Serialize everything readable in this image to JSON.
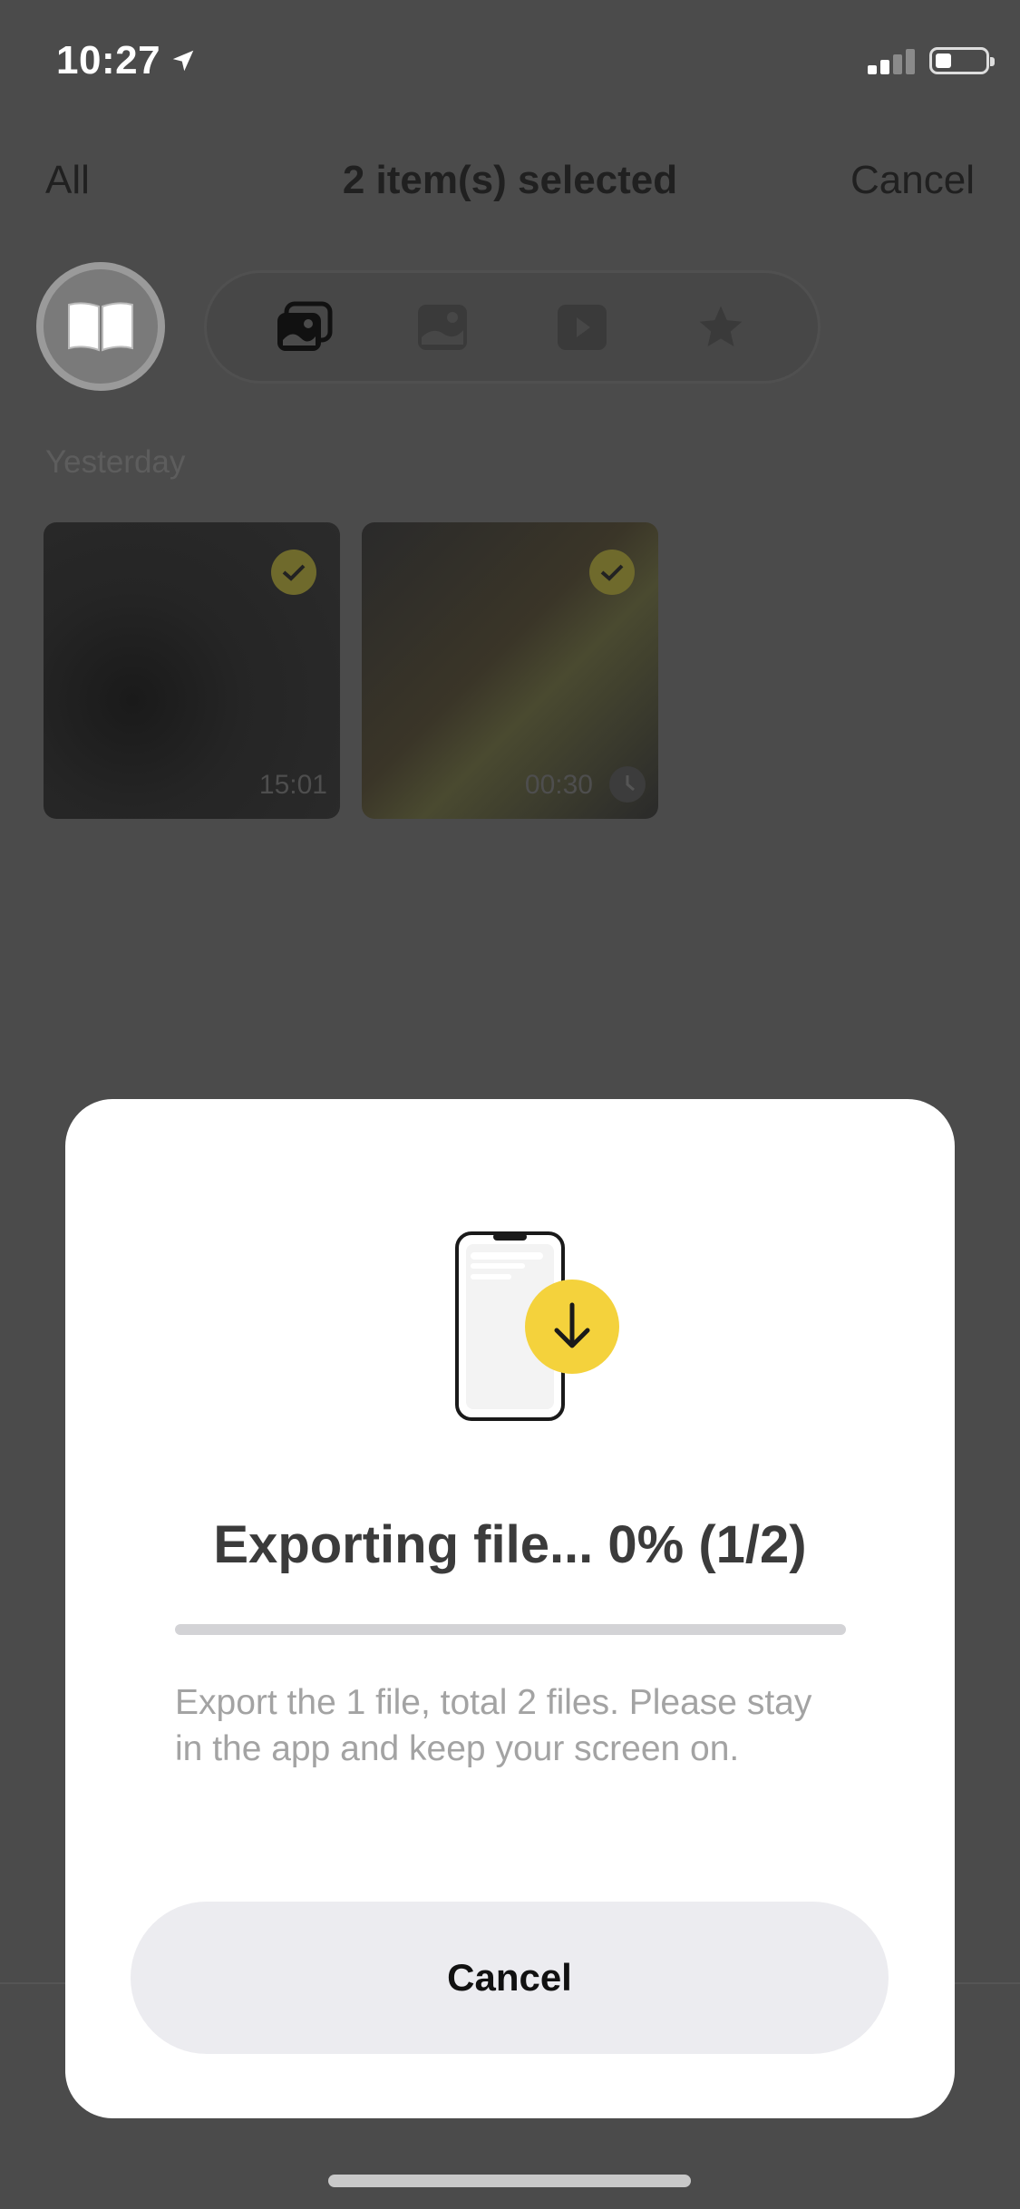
{
  "status_bar": {
    "time": "10:27"
  },
  "nav": {
    "left": "All",
    "title": "2 item(s) selected",
    "right": "Cancel"
  },
  "filters": {
    "items": [
      {
        "icon": "photos-icon"
      },
      {
        "icon": "image-icon"
      },
      {
        "icon": "video-icon"
      },
      {
        "icon": "star-icon"
      }
    ]
  },
  "section": {
    "label": "Yesterday"
  },
  "thumbnails": [
    {
      "duration": "15:01",
      "selected": true
    },
    {
      "duration": "00:30",
      "selected": true
    }
  ],
  "modal": {
    "title": "Exporting file... 0% (1/2)",
    "progress": 0,
    "message": "Export the 1 file, total 2 files. Please stay in the app and keep your screen on.",
    "cancel_label": "Cancel"
  },
  "colors": {
    "accent": "#f4d23c",
    "overlay": "#4b4b4b"
  }
}
